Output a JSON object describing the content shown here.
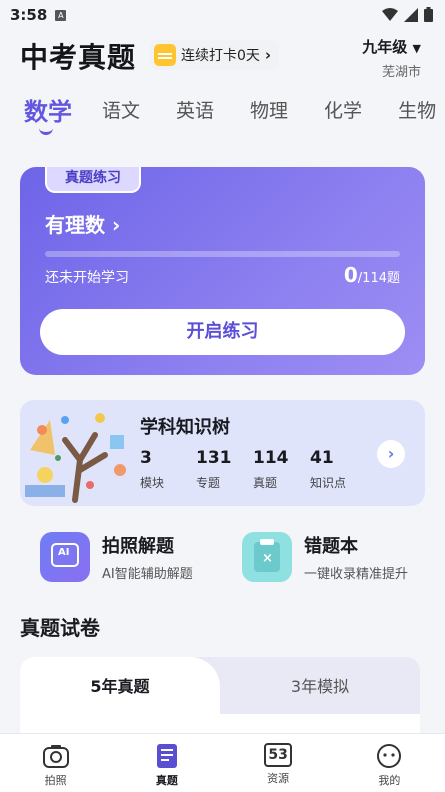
{
  "status_bar": {
    "time": "3:58",
    "a_icon": "A"
  },
  "header": {
    "title": "中考真题",
    "checkin_label": "连续打卡0天",
    "grade": "九年级",
    "city": "芜湖市"
  },
  "subjects": [
    "数学",
    "语文",
    "英语",
    "物理",
    "化学",
    "生物"
  ],
  "practice": {
    "tag": "真题练习",
    "topic": "有理数",
    "status": "还未开始学习",
    "done": "0",
    "total_text": "/114题",
    "progress_fraction": 0,
    "start_label": "开启练习"
  },
  "knowledge_tree": {
    "title": "学科知识树",
    "stats": [
      {
        "value": "3",
        "label": "模块"
      },
      {
        "value": "131",
        "label": "专题"
      },
      {
        "value": "114",
        "label": "真题"
      },
      {
        "value": "41",
        "label": "知识点"
      }
    ]
  },
  "tools": [
    {
      "title": "拍照解题",
      "subtitle": "AI智能辅助解题",
      "icon_text": "AI"
    },
    {
      "title": "错题本",
      "subtitle": "一键收录精准提升"
    }
  ],
  "papers": {
    "section_title": "真题试卷",
    "tabs": [
      "5年真题",
      "3年模拟"
    ]
  },
  "bottom_nav": [
    {
      "label": "拍照",
      "icon": "camera-icon"
    },
    {
      "label": "真题",
      "icon": "book-icon"
    },
    {
      "label": "资源",
      "icon": "53-icon",
      "icon_text": "53"
    },
    {
      "label": "我的",
      "icon": "face-icon"
    }
  ],
  "colors": {
    "accent": "#6356e0",
    "practice_card": "#7a6fec",
    "tree_card": "#dfe4fb"
  }
}
